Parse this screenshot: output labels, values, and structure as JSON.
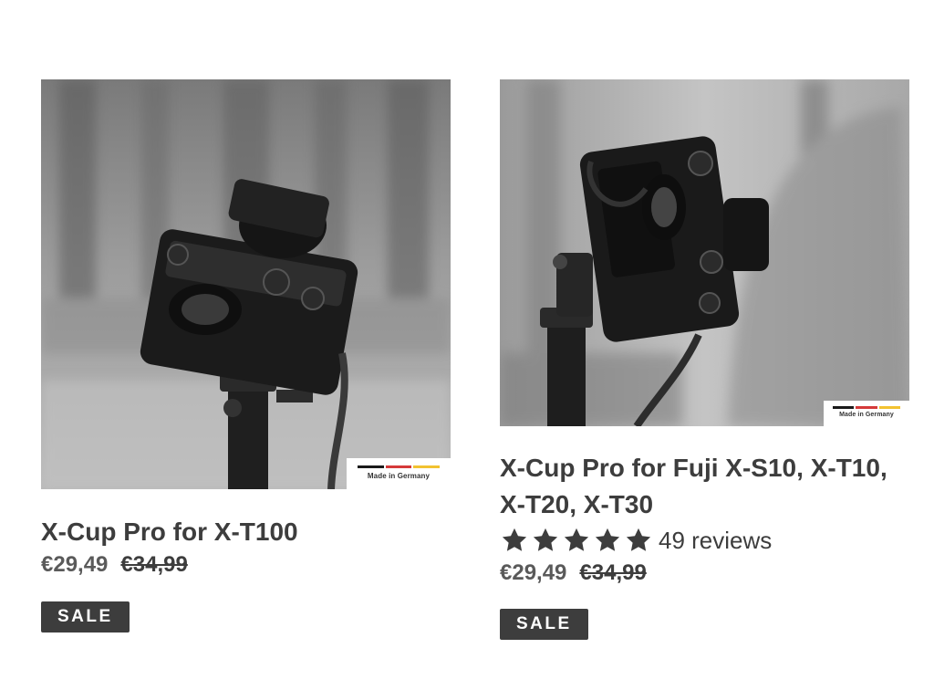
{
  "products": [
    {
      "title": "X-Cup Pro for X-T100",
      "price": "€29,49",
      "compare_price": "€34,99",
      "badge": "SALE",
      "made_label": "Made in Germany",
      "image_icon": "camera-photo"
    },
    {
      "title": "X-Cup Pro for Fuji X-S10, X-T10, X-T20, X-T30",
      "rating": 5,
      "reviews": "49 reviews",
      "price": "€29,49",
      "compare_price": "€34,99",
      "badge": "SALE",
      "made_label": "Made in Germany",
      "image_icon": "camera-photo"
    }
  ],
  "colors": {
    "text": "#3d3d3d",
    "badge_bg": "#3d3d3d",
    "badge_text": "#ffffff",
    "flag_black": "#1a1a1a",
    "flag_red": "#d53a3a",
    "flag_gold": "#f2c230"
  }
}
